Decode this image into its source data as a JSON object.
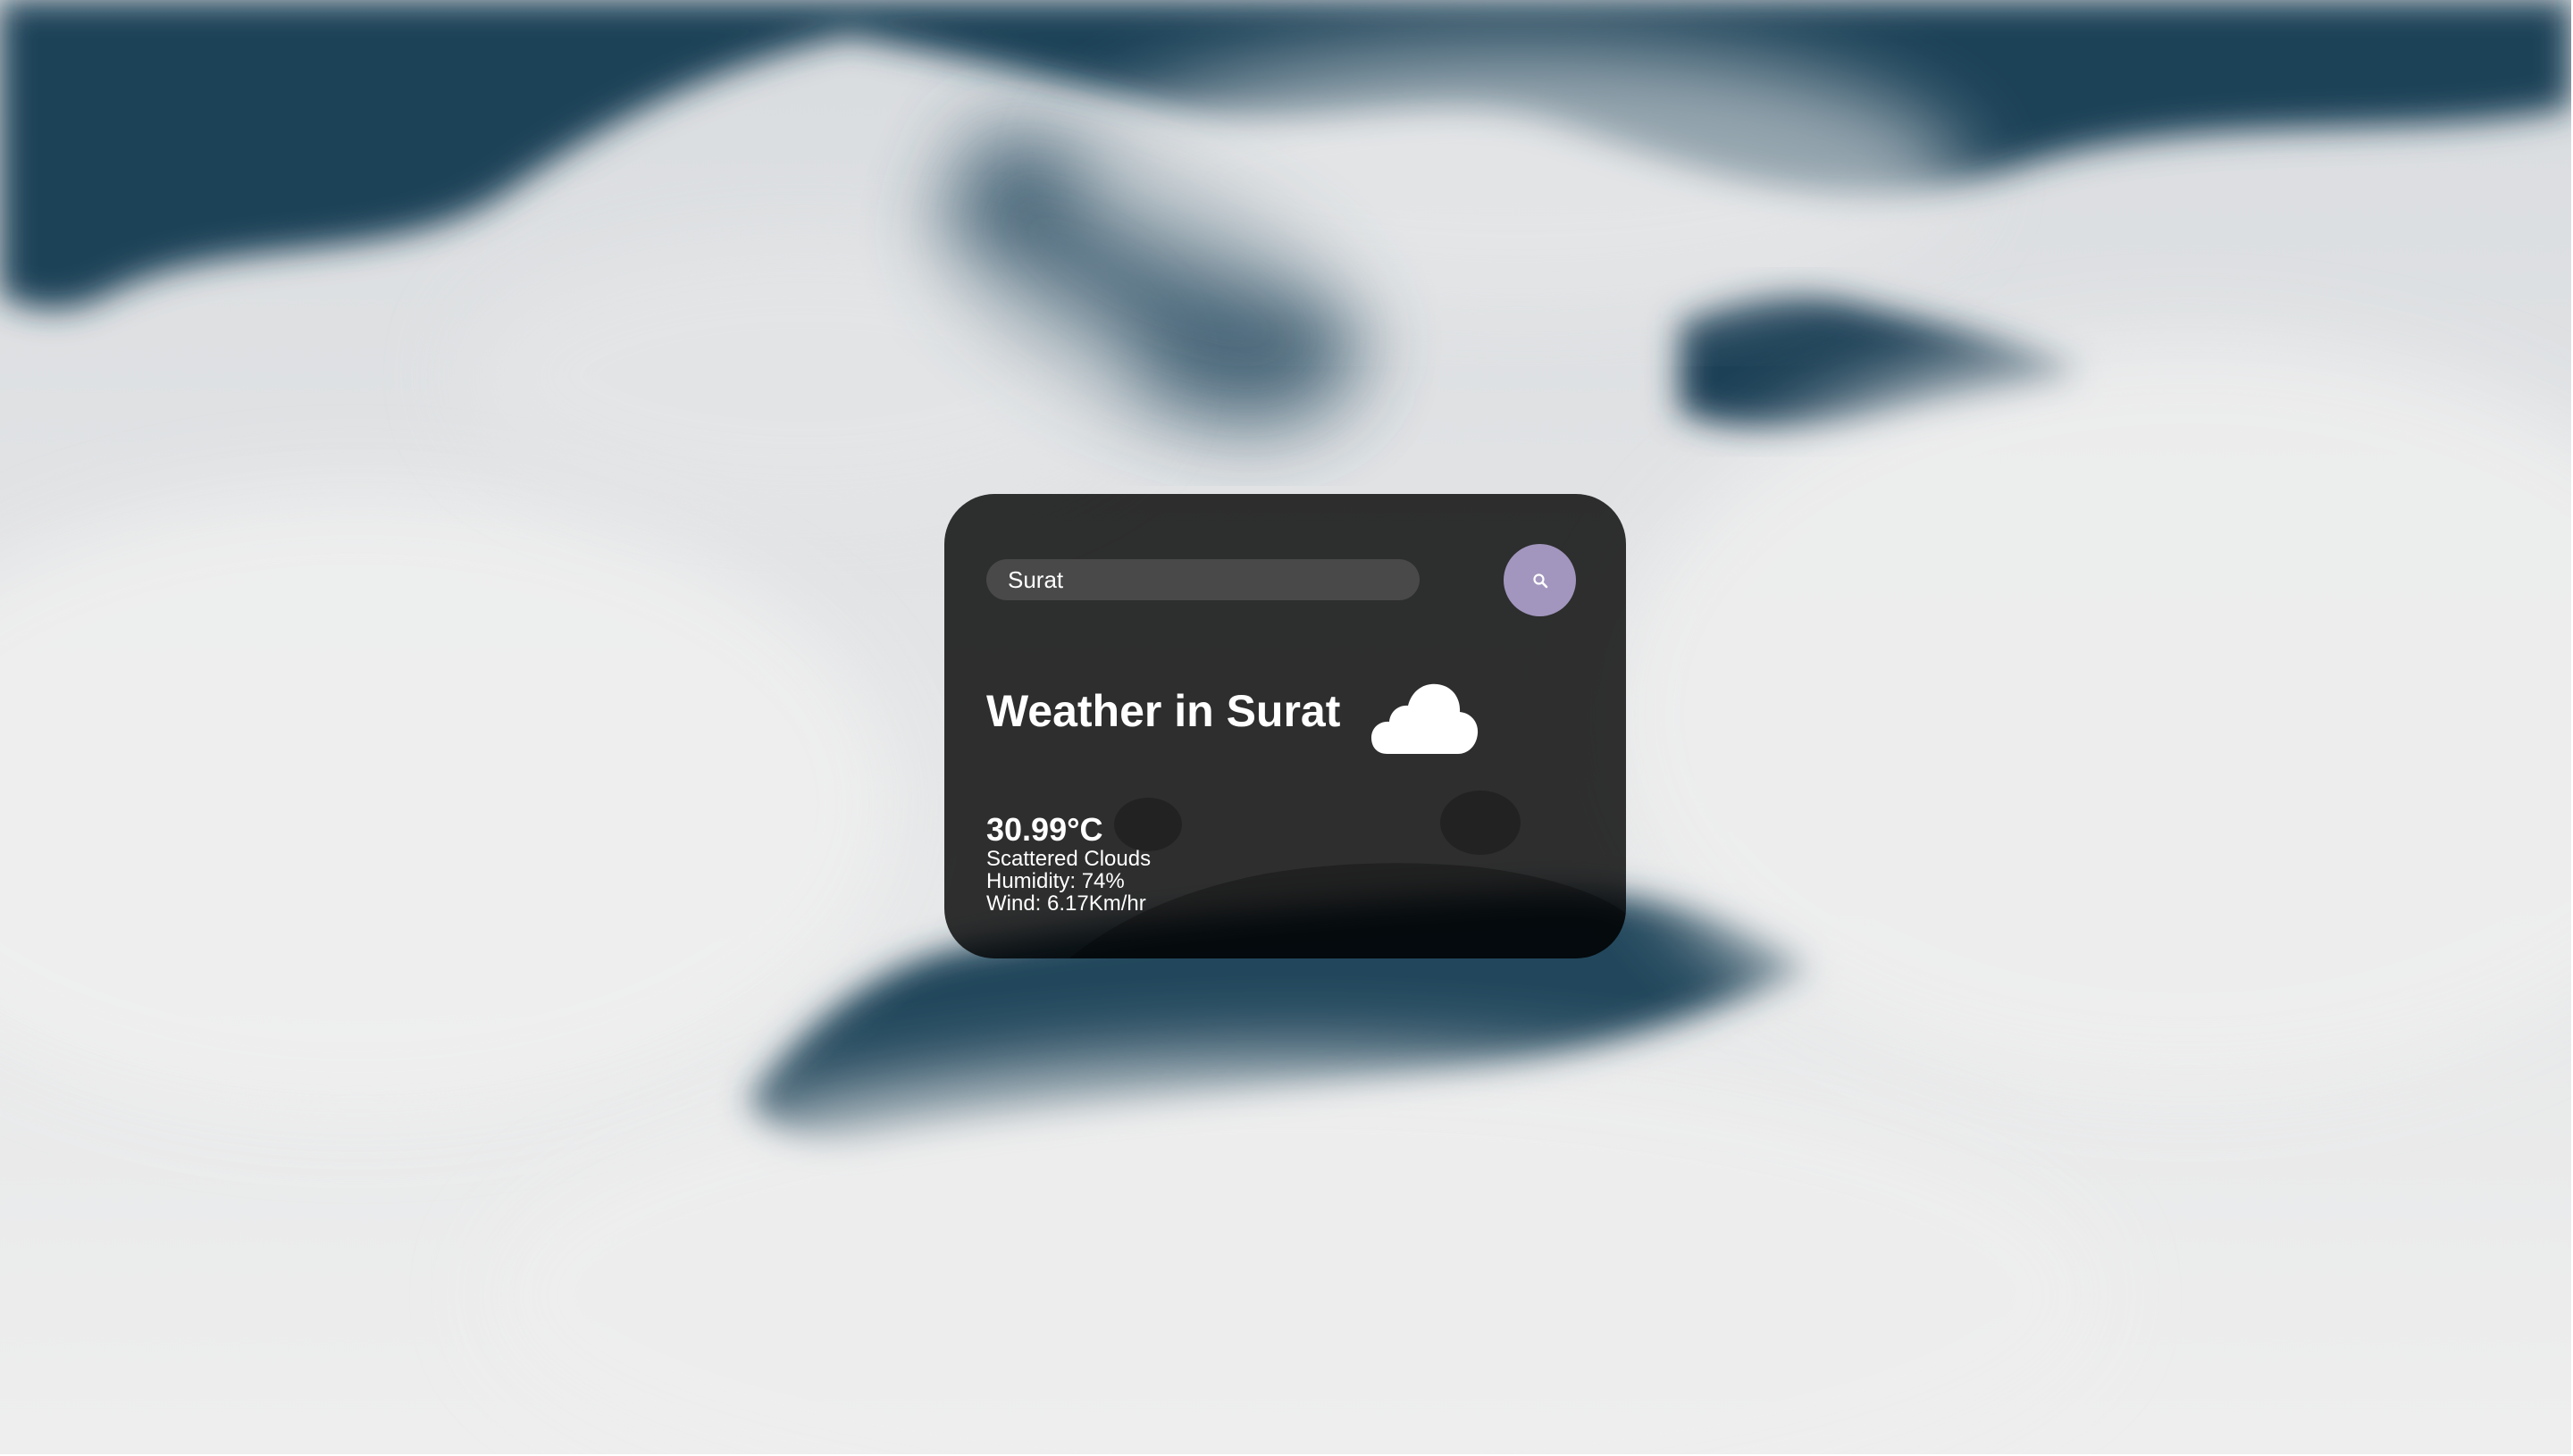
{
  "background": {
    "scene": "misty mountain landscape",
    "sky_color": "#e6e7e8",
    "mountain_color": "#1c3d52"
  },
  "search": {
    "value": "Surat",
    "icon": "search-icon",
    "button_color": "#a296be"
  },
  "weather": {
    "title": "Weather in Surat",
    "icon": "cloud-icon",
    "temperature": "30.99°C",
    "description": "Scattered Clouds",
    "humidity": "Humidity: 74%",
    "wind": "Wind: 6.17Km/hr"
  }
}
